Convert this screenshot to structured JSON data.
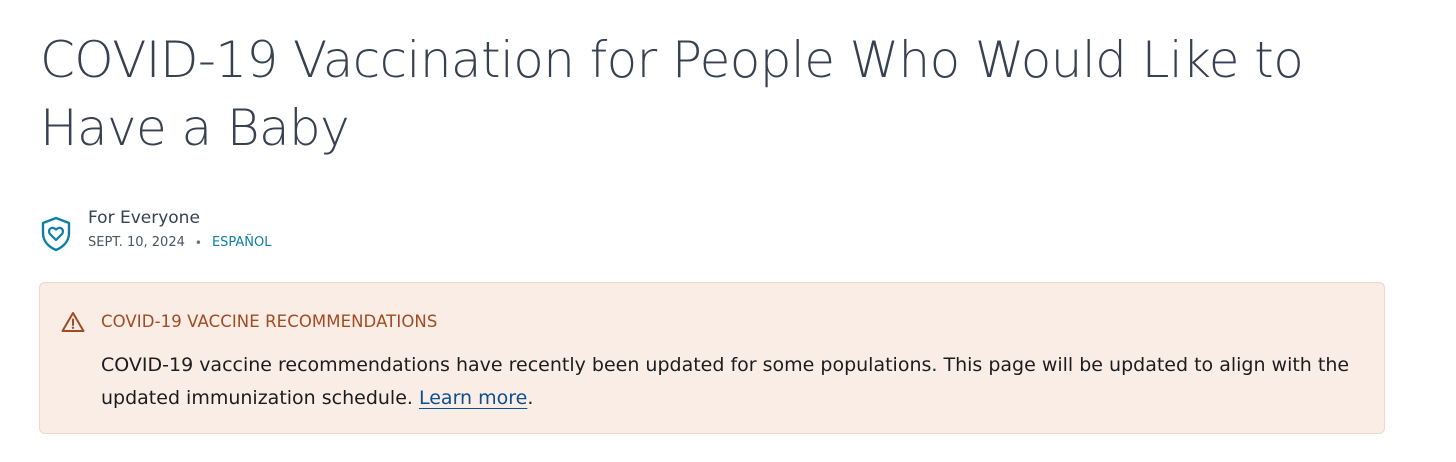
{
  "page": {
    "title": "COVID-19 Vaccination for People Who Would Like to Have a Baby"
  },
  "meta": {
    "icon": "shield-heart-icon",
    "audience": "For Everyone",
    "date": "SEPT. 10, 2024",
    "separator": "•",
    "language_link": "ESPAÑOL"
  },
  "alert": {
    "icon": "warning-triangle-icon",
    "title": "COVID-19 VACCINE RECOMMENDATIONS",
    "body_text": "COVID-19 vaccine recommendations have recently been updated for some populations. This page will be updated to align with the updated immunization schedule. ",
    "link_text": "Learn more",
    "trailing": "."
  },
  "colors": {
    "title": "#374151",
    "accent_teal": "#0f7fa3",
    "alert_bg": "#f9ede6",
    "alert_border": "#f2d6c7",
    "alert_title": "#a24b22",
    "link": "#0b4f8f"
  }
}
